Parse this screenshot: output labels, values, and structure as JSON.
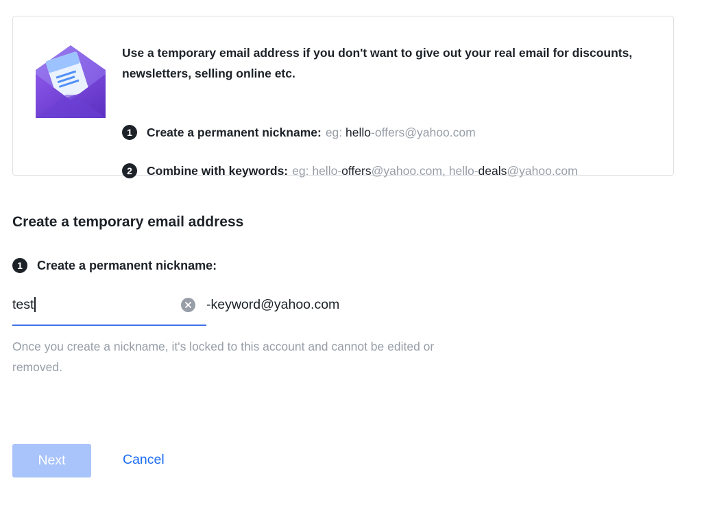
{
  "info": {
    "intro": "Use a temporary email address if you don't want to give out your real email for discounts, newsletters, selling online etc.",
    "step1": {
      "number": "1",
      "label": "Create a permanent nickname:",
      "eg": "eg:",
      "nick": "hello",
      "keyword": "-offers@yahoo.com"
    },
    "step2": {
      "number": "2",
      "label": "Combine with keywords:",
      "eg": "eg:",
      "ex1_nick": "hello-",
      "ex1_keyword": "offers",
      "ex1_domain": "@yahoo.com,",
      "ex2_nick": "hello-",
      "ex2_keyword": "deals",
      "ex2_domain": "@yahoo.com"
    },
    "icon": "envelope-letter-icon",
    "colors": {
      "envelope_purple": "#6b3fd1",
      "letter_blue": "#4f8ff7"
    }
  },
  "form": {
    "title": "Create a temporary email address",
    "step_number": "1",
    "step_label": "Create a permanent nickname:",
    "nickname_value": "test",
    "suffix": "-keyword@yahoo.com",
    "help": "Once you create a nickname, it's locked to this account and cannot be edited or removed.",
    "clear_icon": "clear-x-icon"
  },
  "actions": {
    "next_label": "Next",
    "cancel_label": "Cancel"
  },
  "colors": {
    "accent": "#1a6bf3",
    "underline": "#3c72e6",
    "disabled_button": "#a9c4fb",
    "muted_text": "#979ea8",
    "text": "#1d2228"
  }
}
